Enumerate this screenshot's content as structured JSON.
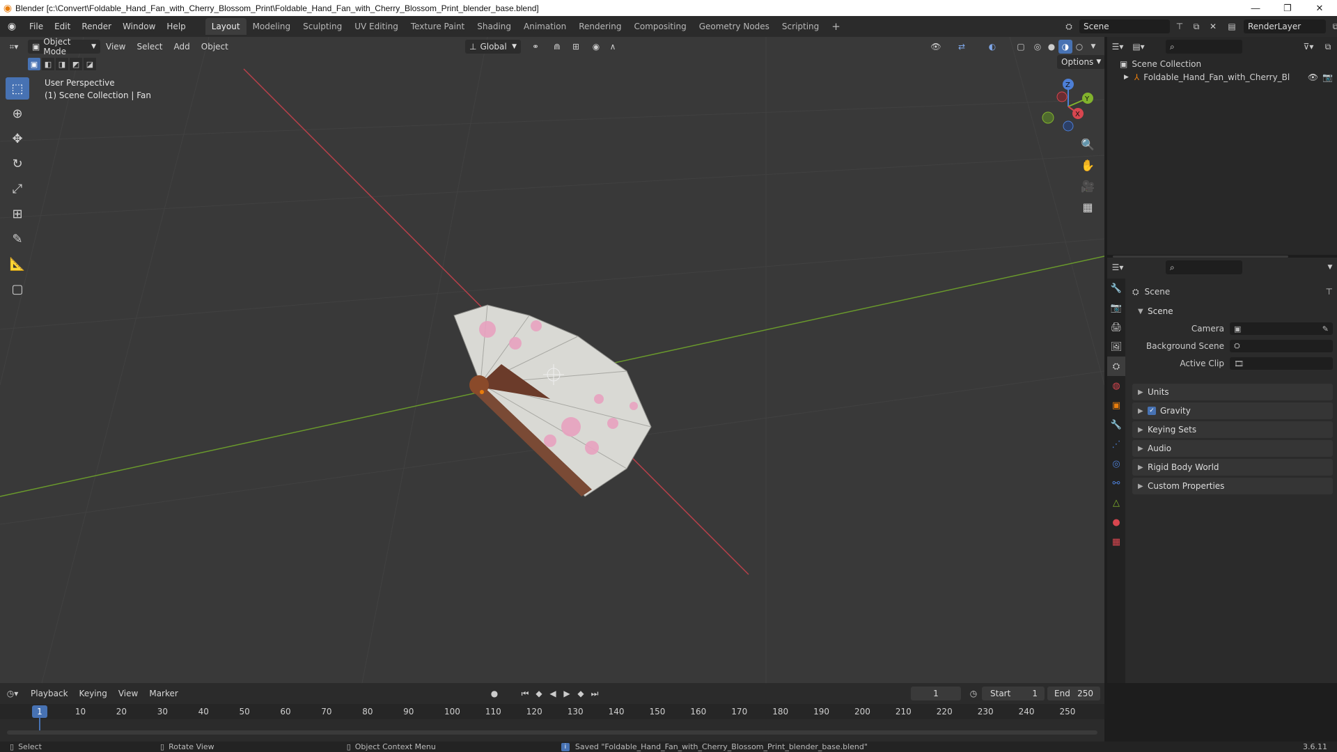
{
  "window": {
    "title": "Blender [c:\\Convert\\Foldable_Hand_Fan_with_Cherry_Blossom_Print\\Foldable_Hand_Fan_with_Cherry_Blossom_Print_blender_base.blend]"
  },
  "menus": [
    "File",
    "Edit",
    "Render",
    "Window",
    "Help"
  ],
  "workspaces": [
    "Layout",
    "Modeling",
    "Sculpting",
    "UV Editing",
    "Texture Paint",
    "Shading",
    "Animation",
    "Rendering",
    "Compositing",
    "Geometry Nodes",
    "Scripting"
  ],
  "active_workspace": "Layout",
  "scene_selector": {
    "value": "Scene"
  },
  "view_layer_selector": {
    "value": "RenderLayer"
  },
  "viewport": {
    "mode": "Object Mode",
    "menus": [
      "View",
      "Select",
      "Add",
      "Object"
    ],
    "transform_orientation": "Global",
    "options_label": "Options",
    "info_line1": "User Perspective",
    "info_line2": "(1) Scene Collection | Fan",
    "gizmo": {
      "x": "X",
      "y": "Y",
      "z": "Z"
    },
    "axis_colors": {
      "x": "#c8404a",
      "y": "#6aa02c"
    }
  },
  "outliner": {
    "root": "Scene Collection",
    "items": [
      {
        "label": "Foldable_Hand_Fan_with_Cherry_Blosso"
      }
    ]
  },
  "properties": {
    "header_title": "Scene",
    "scene_section": "Scene",
    "camera_label": "Camera",
    "background_scene_label": "Background Scene",
    "active_clip_label": "Active Clip",
    "sections": [
      "Units",
      "Gravity",
      "Keying Sets",
      "Audio",
      "Rigid Body World",
      "Custom Properties"
    ],
    "gravity_checked": true
  },
  "timeline": {
    "menus": [
      "Playback",
      "Keying",
      "View",
      "Marker"
    ],
    "current_frame": "1",
    "start_label": "Start",
    "start": "1",
    "end_label": "End",
    "end": "250",
    "ticks": [
      "10",
      "20",
      "30",
      "40",
      "50",
      "60",
      "70",
      "80",
      "90",
      "100",
      "110",
      "120",
      "130",
      "140",
      "150",
      "160",
      "170",
      "180",
      "190",
      "200",
      "210",
      "220",
      "230",
      "240",
      "250"
    ],
    "playhead_label": "1"
  },
  "statusbar": {
    "select": "Select",
    "rotate": "Rotate View",
    "context": "Object Context Menu",
    "message": "Saved \"Foldable_Hand_Fan_with_Cherry_Blossom_Print_blender_base.blend\"",
    "version": "3.6.11"
  },
  "theme": {
    "accent": "#4772b3",
    "orange": "#e87d0d"
  }
}
